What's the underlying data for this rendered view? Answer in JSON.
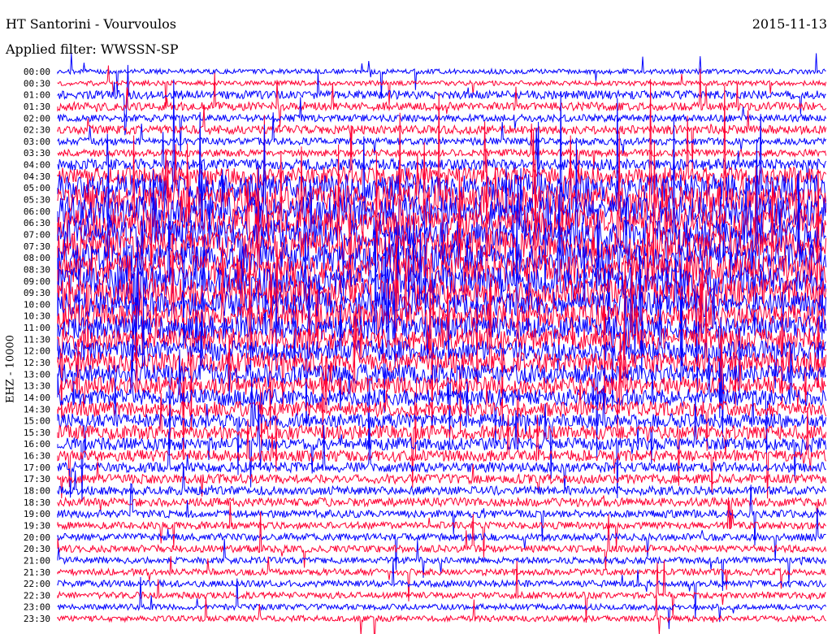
{
  "header": {
    "title": "HT Santorini - Vourvoulos",
    "filter": "Applied filter: WWSSN-SP",
    "date": "2015-11-13"
  },
  "chart_data": {
    "type": "helicorder",
    "station": "HT Santorini - Vourvoulos",
    "filter": "WWSSN-SP",
    "date": "2015-11-13",
    "channel_label": "EHZ - 10000",
    "trace_colors": [
      "#0000ff",
      "#ff0033"
    ],
    "row_labels": [
      "00:00",
      "00:30",
      "01:00",
      "01:30",
      "02:00",
      "02:30",
      "03:00",
      "03:30",
      "04:00",
      "04:30",
      "05:00",
      "05:30",
      "06:00",
      "06:30",
      "07:00",
      "07:30",
      "08:00",
      "08:30",
      "09:00",
      "09:30",
      "10:00",
      "10:30",
      "11:00",
      "11:30",
      "12:00",
      "12:30",
      "13:00",
      "13:30",
      "14:00",
      "14:30",
      "15:00",
      "15:30",
      "16:00",
      "16:30",
      "17:00",
      "17:30",
      "18:00",
      "18:30",
      "19:00",
      "19:30",
      "20:00",
      "20:30",
      "21:00",
      "21:30",
      "22:00",
      "22:30",
      "23:00",
      "23:30"
    ],
    "activity_level": [
      0.12,
      0.12,
      0.25,
      0.25,
      0.2,
      0.25,
      0.2,
      0.2,
      0.35,
      0.6,
      0.95,
      1,
      1,
      1,
      1,
      1,
      1,
      1,
      0.95,
      0.95,
      0.85,
      0.85,
      0.8,
      0.75,
      0.7,
      0.7,
      0.65,
      0.6,
      0.55,
      0.5,
      0.45,
      0.45,
      0.4,
      0.35,
      0.3,
      0.28,
      0.25,
      0.25,
      0.22,
      0.2,
      0.2,
      0.2,
      0.18,
      0.18,
      0.18,
      0.18,
      0.15,
      0.15
    ]
  }
}
